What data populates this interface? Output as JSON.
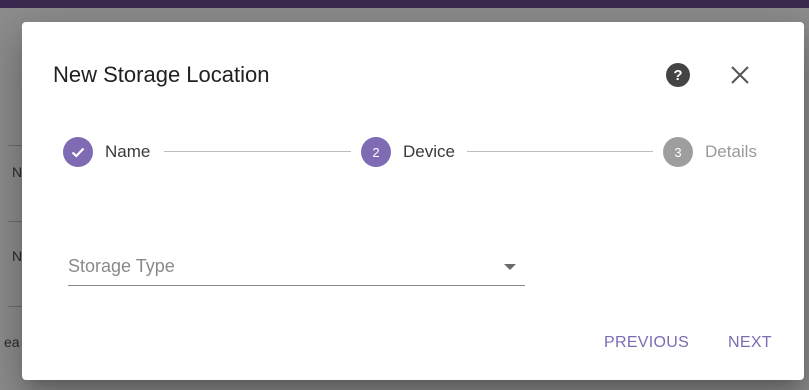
{
  "background": {
    "fragments": [
      "N",
      "N",
      "ea"
    ]
  },
  "dialog": {
    "title": "New Storage Location",
    "help_icon": "help-circle-icon",
    "close_icon": "close-icon"
  },
  "stepper": {
    "steps": [
      {
        "number": "1",
        "label": "Name",
        "state": "completed"
      },
      {
        "number": "2",
        "label": "Device",
        "state": "active"
      },
      {
        "number": "3",
        "label": "Details",
        "state": "pending"
      }
    ]
  },
  "storage_type": {
    "placeholder": "Storage Type",
    "value": ""
  },
  "actions": {
    "previous": "PREVIOUS",
    "next": "NEXT"
  },
  "colors": {
    "accent": "#7e6bb3",
    "pending": "#9e9e9e",
    "overlay": "#8d8d8d",
    "topbar": "#3a2a4f"
  }
}
